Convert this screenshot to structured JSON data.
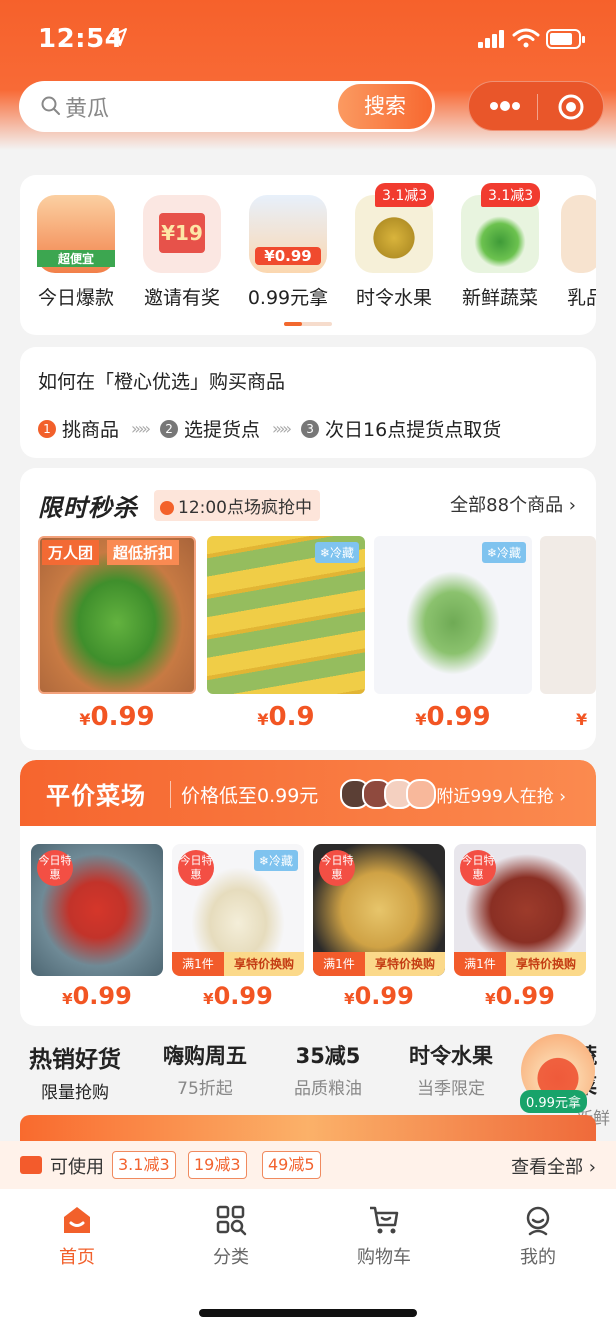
{
  "status": {
    "time": "12:54"
  },
  "search": {
    "placeholder": "黄瓜",
    "button": "搜索"
  },
  "categories": [
    {
      "label": "今日爆款",
      "img_text": "超便宜",
      "color": "#f5a46a"
    },
    {
      "label": "邀请有奖",
      "img_text": "¥19",
      "color": "#e7524a"
    },
    {
      "label": "0.99元拿",
      "img_text": "¥0.99",
      "color": "#f2a23b"
    },
    {
      "label": "时令水果",
      "badge": "3.1减3",
      "color": "#e6c043"
    },
    {
      "label": "新鲜蔬菜",
      "badge": "3.1减3",
      "color": "#67b64a"
    },
    {
      "label": "乳品",
      "color": "#f2d6b9"
    }
  ],
  "howto": {
    "title": "如何在「橙心优选」购买商品",
    "steps": [
      "挑商品",
      "选提货点",
      "次日16点提货点取货"
    ]
  },
  "flash": {
    "title": "限时秒杀",
    "time": "12:00点场疯抢中",
    "all": "全部88个商品",
    "tag1": "万人团",
    "tag2": "超低折扣",
    "cold": "❄冷藏",
    "products": [
      {
        "price": "0.99",
        "color": "#58a438"
      },
      {
        "price": "0.9",
        "color": "#e9c23f",
        "cold": true
      },
      {
        "price": "0.99",
        "color": "#7fb765",
        "cold": true
      },
      {
        "price": "",
        "color": "#ead9cd"
      }
    ]
  },
  "market": {
    "title": "平价菜场",
    "sub": "价格低至0.99元",
    "near": "附近999人在抢",
    "today": "今日特惠",
    "bar_left": "满1件",
    "bar_right": "享特价换购",
    "cold": "❄冷藏",
    "products": [
      {
        "price": "0.99",
        "color": "#c7372b"
      },
      {
        "price": "0.99",
        "color": "#ece6d4",
        "cold": true
      },
      {
        "price": "0.99",
        "color": "#d8b04f"
      },
      {
        "price": "0.99",
        "color": "#9b3b2a"
      }
    ]
  },
  "tabs": [
    {
      "title": "热销好货",
      "sub": "限量抢购"
    },
    {
      "title": "嗨购周五",
      "sub": "75折起"
    },
    {
      "title": "35减5",
      "sub": "品质粮油"
    },
    {
      "title": "时令水果",
      "sub": "当季限定"
    },
    {
      "title": "蔬菜",
      "sub": "新鲜"
    }
  ],
  "fab": {
    "label": "0.99元拿"
  },
  "coupons": {
    "label": "可使用",
    "items": [
      "3.1减3",
      "19减3",
      "49减5"
    ],
    "all": "查看全部"
  },
  "nav": [
    {
      "label": "首页",
      "icon": "home-icon"
    },
    {
      "label": "分类",
      "icon": "category-icon"
    },
    {
      "label": "购物车",
      "icon": "cart-icon"
    },
    {
      "label": "我的",
      "icon": "profile-icon"
    }
  ],
  "colors": {
    "accent": "#f2602b",
    "price": "#f25523"
  }
}
